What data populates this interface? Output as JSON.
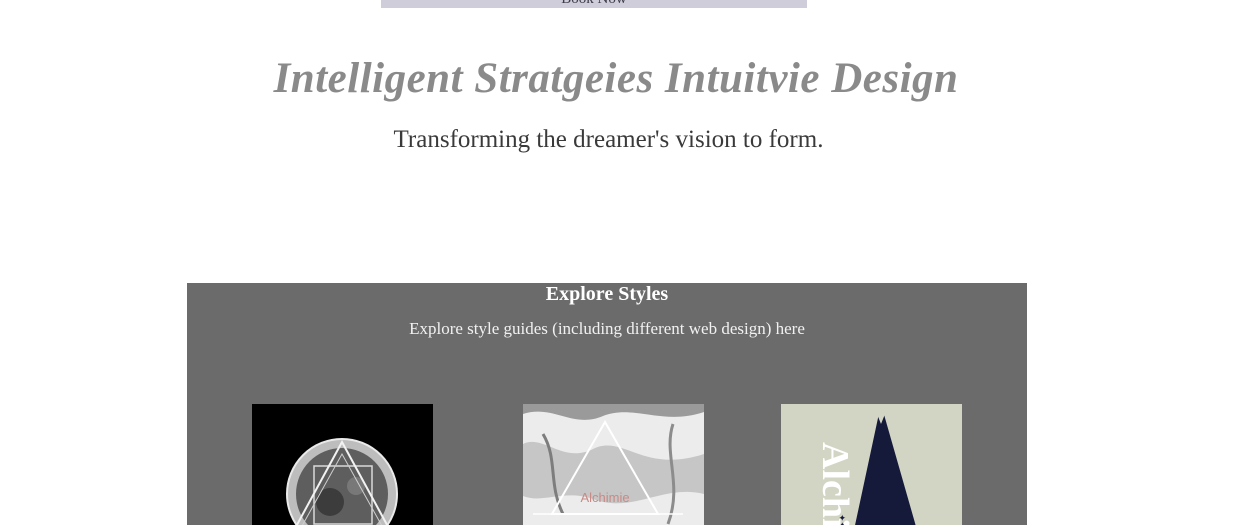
{
  "header": {
    "book_now_label": "Book Now"
  },
  "hero": {
    "title": "Intelligent Stratgeies Intuitvie Design",
    "subtitle": "Transforming the dreamer's vision to form."
  },
  "explore": {
    "title": "Explore Styles",
    "description": "Explore style guides (including different web design) here",
    "cards": [
      {
        "image": "dark-circle-triangle-emblem"
      },
      {
        "image": "grunge-triangle-emblem",
        "text": "Alchimie"
      },
      {
        "image": "navy-triangle-poster",
        "text": "Alchi"
      }
    ]
  },
  "colors": {
    "page_bg": "#ffffff",
    "panel_bg": "#6b6b6b",
    "title_gray": "#8a8a8a",
    "book_bar": "#cfcdd9",
    "navy": "#15193a"
  }
}
